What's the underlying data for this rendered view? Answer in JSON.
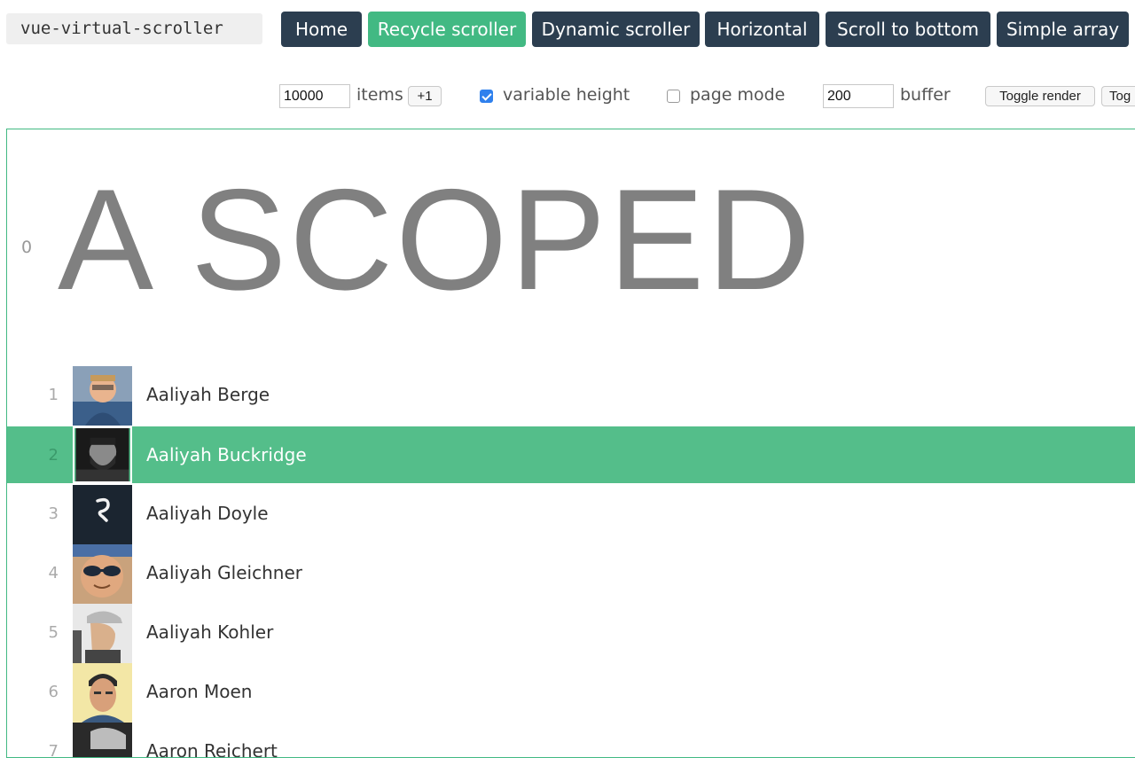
{
  "header": {
    "lib_name": "vue-virtual-scroller",
    "nav": [
      {
        "label": "Home",
        "active": false
      },
      {
        "label": "Recycle scroller",
        "active": true
      },
      {
        "label": "Dynamic scroller",
        "active": false
      },
      {
        "label": "Horizontal",
        "active": false
      },
      {
        "label": "Scroll to bottom",
        "active": false
      },
      {
        "label": "Simple array",
        "active": false
      }
    ]
  },
  "controls": {
    "count_value": "10000",
    "items_label": "items",
    "plus_one_label": "+1",
    "variable_height_label": "variable height",
    "variable_height_checked": true,
    "page_mode_label": "page mode",
    "page_mode_checked": false,
    "buffer_value": "200",
    "buffer_label": "buffer",
    "toggle_render_label": "Toggle render",
    "toggle_truncated_label": "Tog"
  },
  "list": {
    "letter_index": "0",
    "letter_title": "A SCOPED",
    "rows": [
      {
        "index": "1",
        "name": "Aaliyah Berge",
        "avatar": "avatar-person-glasses-icon"
      },
      {
        "index": "2",
        "name": "Aaliyah Buckridge",
        "avatar": "avatar-bearded-man-bw-icon",
        "selected": true
      },
      {
        "index": "3",
        "name": "Aaliyah Doyle",
        "avatar": "avatar-dark-logo-icon"
      },
      {
        "index": "4",
        "name": "Aaliyah Gleichner",
        "avatar": "avatar-sunglasses-man-icon"
      },
      {
        "index": "5",
        "name": "Aaliyah Kohler",
        "avatar": "avatar-cap-profile-icon"
      },
      {
        "index": "6",
        "name": "Aaron Moen",
        "avatar": "avatar-man-yellow-bg-icon"
      },
      {
        "index": "7",
        "name": "Aaron Reichert",
        "avatar": "avatar-bw-photo-icon"
      }
    ]
  },
  "colors": {
    "accent": "#42b983",
    "selected_row": "#54be8a",
    "nav_dark": "#2c3e50"
  }
}
